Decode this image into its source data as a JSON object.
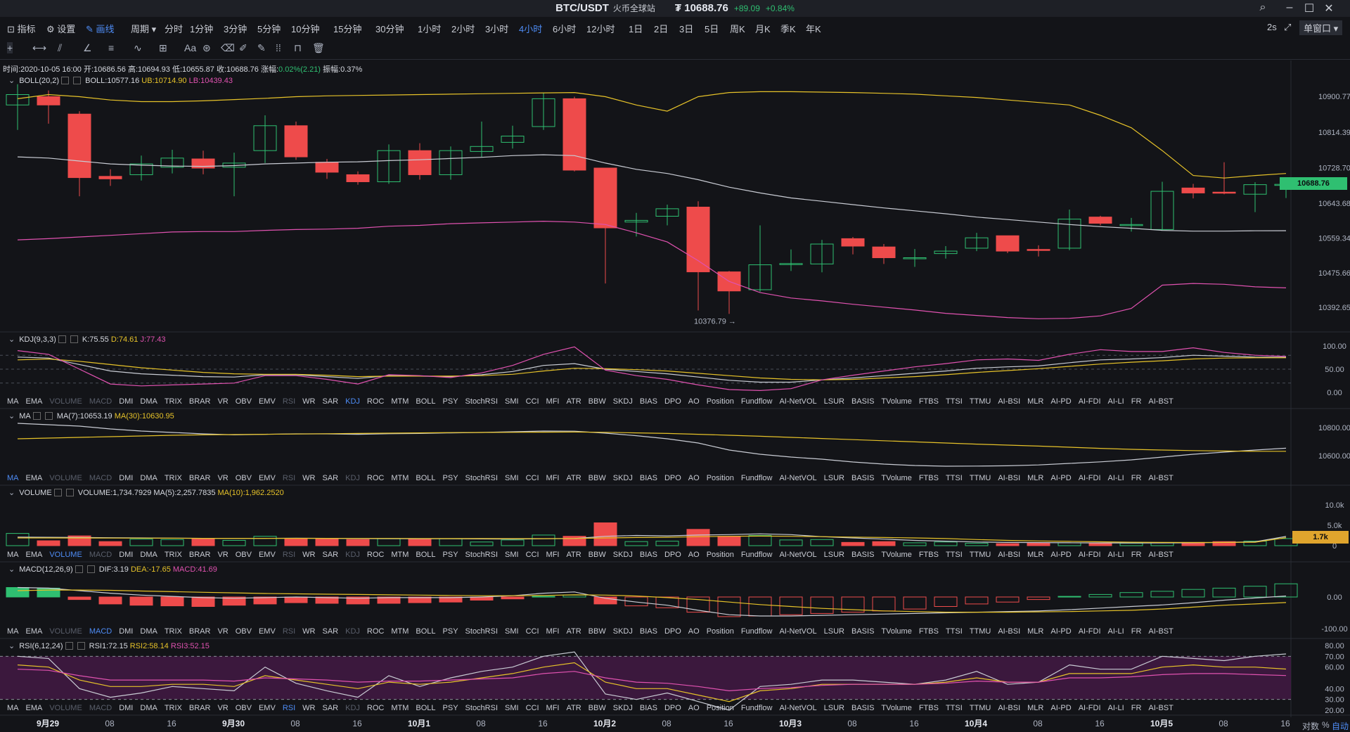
{
  "window": {
    "symbol": "BTC/USDT",
    "exchange": "火币全球站",
    "price": "₮ 10688.76",
    "change": "+89.09",
    "change_pct": "+0.84%"
  },
  "toolbar": {
    "indicators": "指标",
    "settings": "设置",
    "draw": "画线",
    "period": "周期",
    "intervals": [
      "分时",
      "1分钟",
      "3分钟",
      "5分钟",
      "10分钟",
      "15分钟",
      "30分钟",
      "1小时",
      "2小时",
      "3小时",
      "4小时",
      "6小时",
      "12小时",
      "1日",
      "2日",
      "3日",
      "5日",
      "周K",
      "月K",
      "季K",
      "年K"
    ],
    "active_interval": "4小时",
    "refresh": "2s",
    "layout": "单窗口"
  },
  "drawing_tools": [
    "crosshair-icon",
    "horizontal-line-icon",
    "trend-line-icon",
    "angle-icon",
    "parallel-channel-icon",
    "wave-icon",
    "grid-icon",
    "text-icon",
    "magnet-icon",
    "eraser-icon",
    "brush-icon",
    "pencil-icon",
    "measure-icon",
    "lock-icon",
    "trash-icon"
  ],
  "text_tool": "Aa",
  "infobar": {
    "time": "时间:2020-10-05 16:00",
    "open": "开:10686.56",
    "high": "高:10694.93",
    "low": "低:10655.87",
    "close": "收:10688.76",
    "change_prefix": "涨幅:",
    "change": "0.02%(2.21)",
    "amplitude": "振幅:0.37%"
  },
  "boll": {
    "label": "BOLL(20,2)",
    "mid": "BOLL:10577.16",
    "ub": "UB:10714.90",
    "lb": "LB:10439.43"
  },
  "kdj": {
    "label": "KDJ(9,3,3)",
    "k": "K:75.55",
    "d": "D:74.61",
    "j": "J:77.43"
  },
  "ma": {
    "label": "MA",
    "ma7": "MA(7):10653.19",
    "ma30": "MA(30):10630.95"
  },
  "volume": {
    "label": "VOLUME",
    "vol": "VOLUME:1,734.7929",
    "ma5": "MA(5):2,257.7835",
    "ma10": "MA(10):1,962.2520"
  },
  "macd": {
    "label": "MACD(12,26,9)",
    "dif": "DIF:3.19",
    "dea": "DEA:-17.65",
    "macd": "MACD:41.69"
  },
  "rsi": {
    "label": "RSI(6,12,24)",
    "rsi1": "RSI1:72.15",
    "rsi2": "RSI2:58.14",
    "rsi3": "RSI3:52.15"
  },
  "indicator_tabs": [
    "MA",
    "EMA",
    "VOLUME",
    "MACD",
    "DMI",
    "DMA",
    "TRIX",
    "BRAR",
    "VR",
    "OBV",
    "EMV",
    "RSI",
    "WR",
    "SAR",
    "KDJ",
    "ROC",
    "MTM",
    "BOLL",
    "PSY",
    "StochRSI",
    "SMI",
    "CCI",
    "MFI",
    "ATR",
    "BBW",
    "SKDJ",
    "BIAS",
    "DPO",
    "AO",
    "Position",
    "Fundflow",
    "AI-NetVOL",
    "LSUR",
    "BASIS",
    "TVolume",
    "FTBS",
    "TTSI",
    "TTMU",
    "AI-BSI",
    "MLR",
    "AI-PD",
    "AI-FDI",
    "AI-LI",
    "FR",
    "AI-BST"
  ],
  "price_axis": [
    "10900.77",
    "10814.39",
    "10728.70",
    "10643.68",
    "10559.34",
    "10475.66",
    "10392.65"
  ],
  "current_price_tag": "10688.76",
  "low_marker": "10376.79 →",
  "kdj_axis": [
    "100.00",
    "50.00",
    "0.00"
  ],
  "ma_axis": [
    "10800.00",
    "10600.00"
  ],
  "vol_axis": [
    "10.0k",
    "5.0k",
    "0"
  ],
  "vol_tag": "1.7k",
  "macd_axis": [
    "0.00",
    "-100.00"
  ],
  "rsi_axis": [
    "80.00",
    "70.00",
    "60.00",
    "40.00",
    "30.00",
    "20.00"
  ],
  "time_axis": [
    {
      "t": "9月29",
      "major": true
    },
    {
      "t": "08"
    },
    {
      "t": "16"
    },
    {
      "t": "9月30",
      "major": true
    },
    {
      "t": "08"
    },
    {
      "t": "16"
    },
    {
      "t": "10月1",
      "major": true
    },
    {
      "t": "08"
    },
    {
      "t": "16"
    },
    {
      "t": "10月2",
      "major": true
    },
    {
      "t": "08"
    },
    {
      "t": "16"
    },
    {
      "t": "10月3",
      "major": true
    },
    {
      "t": "08"
    },
    {
      "t": "16"
    },
    {
      "t": "10月4",
      "major": true
    },
    {
      "t": "08"
    },
    {
      "t": "16"
    },
    {
      "t": "10月5",
      "major": true
    },
    {
      "t": "08"
    },
    {
      "t": "16"
    }
  ],
  "bottom_right": {
    "log": "对数",
    "pct": "%",
    "auto": "自动"
  },
  "colors": {
    "up": "#2fbf71",
    "down": "#ee4b4b",
    "boll_ub": "#e6c229",
    "boll_lb": "#e052b0",
    "boll_mid": "#c9ccd4",
    "accent": "#4e8cf5"
  },
  "chart_data": {
    "type": "candlestick",
    "interval": "4小时",
    "candles": [
      {
        "o": 10880,
        "c": 10905,
        "h": 10930,
        "l": 10820
      },
      {
        "o": 10900,
        "c": 10880,
        "h": 10915,
        "l": 10835
      },
      {
        "o": 10858,
        "c": 10705,
        "h": 10865,
        "l": 10660
      },
      {
        "o": 10708,
        "c": 10702,
        "h": 10725,
        "l": 10685
      },
      {
        "o": 10712,
        "c": 10738,
        "h": 10758,
        "l": 10698
      },
      {
        "o": 10730,
        "c": 10752,
        "h": 10772,
        "l": 10715
      },
      {
        "o": 10750,
        "c": 10728,
        "h": 10770,
        "l": 10713
      },
      {
        "o": 10730,
        "c": 10740,
        "h": 10765,
        "l": 10660
      },
      {
        "o": 10770,
        "c": 10830,
        "h": 10855,
        "l": 10740
      },
      {
        "o": 10830,
        "c": 10755,
        "h": 10840,
        "l": 10748
      },
      {
        "o": 10742,
        "c": 10718,
        "h": 10750,
        "l": 10702
      },
      {
        "o": 10712,
        "c": 10695,
        "h": 10720,
        "l": 10688
      },
      {
        "o": 10695,
        "c": 10770,
        "h": 10785,
        "l": 10690
      },
      {
        "o": 10770,
        "c": 10712,
        "h": 10788,
        "l": 10700
      },
      {
        "o": 10712,
        "c": 10770,
        "h": 10780,
        "l": 10700
      },
      {
        "o": 10768,
        "c": 10780,
        "h": 10840,
        "l": 10755
      },
      {
        "o": 10790,
        "c": 10805,
        "h": 10830,
        "l": 10775
      },
      {
        "o": 10828,
        "c": 10895,
        "h": 10910,
        "l": 10820
      },
      {
        "o": 10895,
        "c": 10723,
        "h": 10900,
        "l": 10720
      },
      {
        "o": 10728,
        "c": 10584,
        "h": 10728,
        "l": 10450
      },
      {
        "o": 10598,
        "c": 10602,
        "h": 10620,
        "l": 10563
      },
      {
        "o": 10612,
        "c": 10630,
        "h": 10640,
        "l": 10590
      },
      {
        "o": 10634,
        "c": 10478,
        "h": 10648,
        "l": 10385
      },
      {
        "o": 10478,
        "c": 10432,
        "h": 10480,
        "l": 10376.79
      },
      {
        "o": 10435,
        "c": 10495,
        "h": 10590,
        "l": 10430
      },
      {
        "o": 10497,
        "c": 10498,
        "h": 10532,
        "l": 10480
      },
      {
        "o": 10497,
        "c": 10545,
        "h": 10555,
        "l": 10477
      },
      {
        "o": 10558,
        "c": 10540,
        "h": 10562,
        "l": 10520
      },
      {
        "o": 10538,
        "c": 10512,
        "h": 10545,
        "l": 10497
      },
      {
        "o": 10510,
        "c": 10512,
        "h": 10533,
        "l": 10490
      },
      {
        "o": 10522,
        "c": 10528,
        "h": 10540,
        "l": 10510
      },
      {
        "o": 10535,
        "c": 10560,
        "h": 10572,
        "l": 10528
      },
      {
        "o": 10565,
        "c": 10528,
        "h": 10565,
        "l": 10523
      },
      {
        "o": 10532,
        "c": 10530,
        "h": 10542,
        "l": 10515
      },
      {
        "o": 10535,
        "c": 10605,
        "h": 10628,
        "l": 10530
      },
      {
        "o": 10610,
        "c": 10595,
        "h": 10613,
        "l": 10590
      },
      {
        "o": 10592,
        "c": 10592,
        "h": 10608,
        "l": 10575
      },
      {
        "o": 10580,
        "c": 10672,
        "h": 10695,
        "l": 10578
      },
      {
        "o": 10680,
        "c": 10668,
        "h": 10690,
        "l": 10655
      },
      {
        "o": 10670,
        "c": 10668,
        "h": 10742,
        "l": 10665
      },
      {
        "o": 10665,
        "c": 10688,
        "h": 10694,
        "l": 10622
      },
      {
        "o": 10686.56,
        "c": 10688.76,
        "h": 10694.93,
        "l": 10655.87
      }
    ],
    "boll_ub": [
      10895,
      10905,
      10900,
      10892,
      10888,
      10888,
      10890,
      10893,
      10896,
      10900,
      10902,
      10903,
      10904,
      10905,
      10906,
      10907,
      10908,
      10909,
      10910,
      10900,
      10880,
      10865,
      10900,
      10910,
      10912,
      10912,
      10911,
      10910,
      10908,
      10906,
      10902,
      10898,
      10892,
      10886,
      10880,
      10855,
      10825,
      10770,
      10710,
      10704,
      10710,
      10714.9
    ],
    "boll_mid": [
      10755,
      10752,
      10745,
      10738,
      10735,
      10733,
      10732,
      10734,
      10738,
      10740,
      10742,
      10743,
      10746,
      10748,
      10751,
      10754,
      10758,
      10760,
      10758,
      10740,
      10725,
      10715,
      10700,
      10682,
      10668,
      10656,
      10648,
      10640,
      10632,
      10625,
      10618,
      10610,
      10604,
      10598,
      10592,
      10587,
      10583,
      10578,
      10576,
      10576,
      10577,
      10577.16
    ],
    "boll_lb": [
      10555,
      10558,
      10562,
      10566,
      10570,
      10574,
      10575,
      10575,
      10578,
      10580,
      10581,
      10583,
      10588,
      10590,
      10594,
      10596,
      10598,
      10600,
      10598,
      10592,
      10572,
      10550,
      10505,
      10455,
      10428,
      10415,
      10408,
      10400,
      10393,
      10386,
      10378,
      10373,
      10368,
      10365,
      10366,
      10372,
      10390,
      10446,
      10450,
      10448,
      10442,
      10439.43
    ],
    "kdj_k": [
      76,
      74,
      60,
      46,
      40,
      37,
      34,
      33,
      38,
      38,
      34,
      30,
      36,
      35,
      34,
      38,
      45,
      58,
      62,
      50,
      45,
      40,
      33,
      26,
      22,
      22,
      27,
      31,
      36,
      41,
      46,
      52,
      55,
      57,
      64,
      70,
      72,
      75,
      80,
      78,
      76,
      75.55
    ],
    "kdj_d": [
      70,
      72,
      67,
      60,
      53,
      48,
      43,
      40,
      39,
      39,
      37,
      34,
      35,
      35,
      35,
      36,
      39,
      46,
      52,
      51,
      49,
      46,
      41,
      36,
      31,
      28,
      27,
      28,
      31,
      34,
      38,
      43,
      47,
      51,
      56,
      61,
      65,
      68,
      72,
      74,
      74.5,
      74.61
    ],
    "kdj_j": [
      90,
      82,
      50,
      18,
      14,
      16,
      18,
      20,
      36,
      36,
      28,
      18,
      38,
      36,
      32,
      42,
      58,
      82,
      98,
      48,
      36,
      28,
      16,
      6,
      4,
      8,
      27,
      37,
      46,
      55,
      62,
      70,
      72,
      69,
      82,
      92,
      88,
      88,
      96,
      86,
      80,
      77.43
    ],
    "ma7": [
      10830,
      10820,
      10810,
      10790,
      10775,
      10765,
      10755,
      10748,
      10752,
      10755,
      10755,
      10752,
      10756,
      10758,
      10762,
      10765,
      10770,
      10775,
      10774,
      10760,
      10742,
      10720,
      10690,
      10640,
      10610,
      10590,
      10575,
      10555,
      10540,
      10530,
      10525,
      10526,
      10528,
      10534,
      10545,
      10556,
      10570,
      10590,
      10610,
      10625,
      10640,
      10653.19
    ],
    "ma30": [
      10720,
      10725,
      10730,
      10735,
      10740,
      10745,
      10748,
      10750,
      10752,
      10754,
      10756,
      10758,
      10760,
      10762,
      10764,
      10765,
      10766,
      10767,
      10768,
      10766,
      10762,
      10758,
      10752,
      10745,
      10738,
      10730,
      10722,
      10714,
      10706,
      10698,
      10690,
      10682,
      10675,
      10668,
      10660,
      10652,
      10645,
      10640,
      10636,
      10633,
      10631,
      10630.95
    ],
    "volume": [
      3000,
      1200,
      2400,
      1000,
      1600,
      1500,
      1700,
      1300,
      2300,
      1700,
      1700,
      1500,
      1700,
      1600,
      1700,
      900,
      1400,
      2600,
      2300,
      5600,
      1000,
      1100,
      4000,
      2300,
      2500,
      1400,
      1500,
      800,
      1000,
      700,
      900,
      600,
      500,
      600,
      700,
      700,
      600,
      700,
      800,
      1000,
      1100,
      1734.79
    ],
    "vol_ma5": [
      2100,
      2050,
      2000,
      1950,
      1900,
      1850,
      1800,
      1780,
      1800,
      1820,
      1800,
      1750,
      1720,
      1700,
      1700,
      1650,
      1600,
      1700,
      1750,
      2300,
      2500,
      2400,
      2600,
      2700,
      2900,
      2700,
      2200,
      1900,
      1600,
      1300,
      1100,
      900,
      800,
      750,
      700,
      680,
      650,
      650,
      700,
      800,
      950,
      2257.78
    ],
    "vol_ma10": [
      1900,
      1900,
      1880,
      1860,
      1840,
      1820,
      1800,
      1790,
      1790,
      1795,
      1790,
      1780,
      1770,
      1760,
      1750,
      1740,
      1720,
      1730,
      1760,
      1900,
      2000,
      2050,
      2200,
      2300,
      2350,
      2300,
      2200,
      2100,
      2000,
      1900,
      1750,
      1500,
      1300,
      1150,
      1050,
      950,
      850,
      800,
      780,
      800,
      850,
      1962.25
    ],
    "macd_hist": [
      30,
      28,
      -8,
      -22,
      -26,
      -28,
      -30,
      -26,
      -22,
      -18,
      -20,
      -22,
      -20,
      -18,
      -16,
      -10,
      -6,
      2,
      6,
      -22,
      -28,
      -34,
      -48,
      -62,
      -60,
      -56,
      -52,
      -48,
      -44,
      -38,
      -30,
      -22,
      -16,
      -8,
      2,
      8,
      14,
      18,
      24,
      28,
      34,
      41.69
    ],
    "macd_dif": [
      30,
      28,
      20,
      12,
      6,
      2,
      -2,
      -4,
      -2,
      0,
      -2,
      -4,
      -2,
      -2,
      -2,
      0,
      4,
      12,
      16,
      -4,
      -16,
      -26,
      -42,
      -56,
      -60,
      -60,
      -58,
      -56,
      -54,
      -52,
      -50,
      -48,
      -46,
      -44,
      -40,
      -35,
      -30,
      -25,
      -18,
      -10,
      -3,
      3.19
    ],
    "macd_dea": [
      20,
      22,
      22,
      21,
      19,
      17,
      15,
      13,
      11,
      10,
      9,
      8,
      7,
      6,
      5,
      4,
      4,
      5,
      7,
      6,
      3,
      -2,
      -8,
      -16,
      -24,
      -30,
      -36,
      -40,
      -44,
      -46,
      -48,
      -48,
      -48,
      -47,
      -46,
      -44,
      -42,
      -38,
      -32,
      -26,
      -22,
      -17.65
    ],
    "rsi1": [
      70,
      68,
      40,
      32,
      36,
      42,
      40,
      38,
      60,
      45,
      38,
      32,
      52,
      42,
      50,
      56,
      60,
      70,
      74,
      35,
      30,
      36,
      28,
      20,
      42,
      44,
      48,
      48,
      46,
      44,
      48,
      56,
      44,
      46,
      62,
      58,
      58,
      70,
      68,
      66,
      70,
      72.15
    ],
    "rsi2": [
      62,
      60,
      48,
      42,
      42,
      44,
      44,
      42,
      52,
      48,
      44,
      40,
      46,
      44,
      46,
      50,
      54,
      60,
      64,
      46,
      40,
      40,
      34,
      28,
      38,
      40,
      44,
      44,
      44,
      44,
      46,
      50,
      46,
      46,
      54,
      54,
      54,
      60,
      62,
      60,
      60,
      58.14
    ],
    "rsi3": [
      58,
      57,
      52,
      48,
      48,
      48,
      48,
      47,
      50,
      49,
      48,
      46,
      47,
      47,
      48,
      49,
      50,
      54,
      56,
      50,
      46,
      45,
      42,
      38,
      40,
      41,
      43,
      44,
      44,
      44,
      45,
      47,
      46,
      46,
      50,
      50,
      51,
      53,
      54,
      54,
      53,
      52.15
    ]
  }
}
